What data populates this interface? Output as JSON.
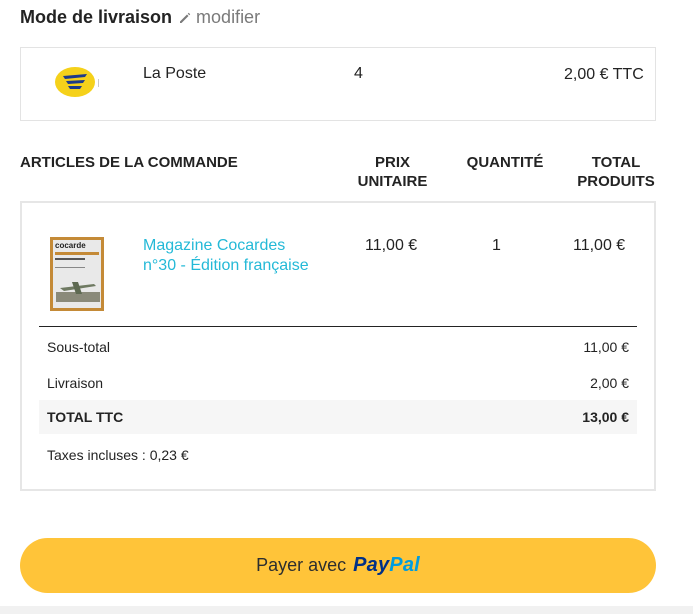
{
  "delivery": {
    "title": "Mode de livraison",
    "edit_label": "modifier",
    "carrier": {
      "logo_icon": "la-poste-logo",
      "name": "La Poste",
      "delay": "4",
      "price": "2,00 € TTC"
    }
  },
  "cart": {
    "headers": {
      "articles": "ARTICLES DE LA COMMANDE",
      "unit_price": "PRIX UNITAIRE",
      "quantity": "QUANTITÉ",
      "total": "TOTAL PRODUITS"
    },
    "product": {
      "thumbnail_title": "cocarde",
      "name": "Magazine Cocardes n°30 - Édition française",
      "unit_price": "11,00 €",
      "quantity": "1",
      "total": "11,00 €"
    },
    "summary": {
      "subtotal_label": "Sous-total",
      "subtotal_value": "11,00 €",
      "shipping_label": "Livraison",
      "shipping_value": "2,00 €",
      "total_label": "TOTAL TTC",
      "total_value": "13,00 €",
      "taxes_label": "Taxes incluses : 0,23 €"
    }
  },
  "payment": {
    "button_label": "Payer avec",
    "brand_part1": "Pay",
    "brand_part2": "Pal",
    "button_color": "#ffc439"
  }
}
